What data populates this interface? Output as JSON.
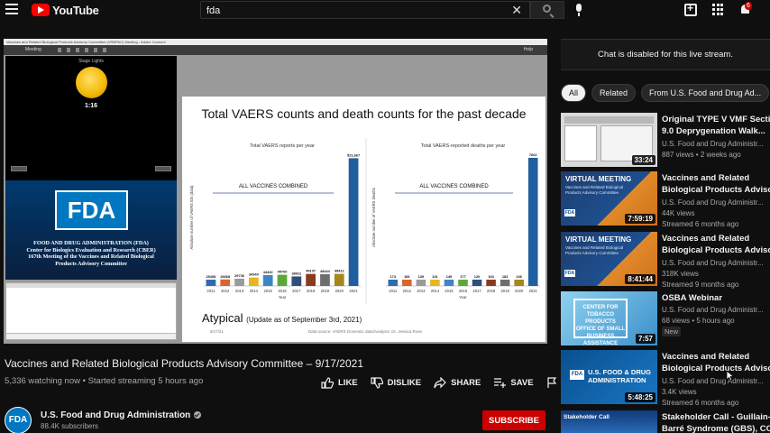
{
  "header": {
    "logo_text": "YouTube",
    "search_value": "fda",
    "notification_count": "6"
  },
  "player": {
    "app_bar_text": "Vaccines and Related Biological Products Advisory Committee (VRBPAC) Meeting - Adobe Connect",
    "toolbar_label": "Meeting",
    "toolbar_help": "Help",
    "pod_title": "Stage Lights",
    "timer": "1:16",
    "fda_logo": "FDA",
    "fda_caption": [
      "FOOD AND DRUG ADMINISTRATION (FDA)",
      "Center for Biologics Evaluation and Research (CBER)",
      "167th Meeting of the Vaccines and Related Biological",
      "Products Advisory Committee"
    ],
    "slide": {
      "title": "Total VAERS counts and death counts for the past decade",
      "atypical": "Atypical",
      "atypical_note": "(Update as of September 3rd, 2021)",
      "footer_date": "9/17/21",
      "footer_source": "Data source: VAERS Domestic data/Analysis: Dr. Jessica Rose"
    }
  },
  "chart_data": [
    {
      "type": "bar",
      "title": "Total VAERS reports per year",
      "annotation": "ALL VACCINES COMBINED",
      "ylabel": "Absolute number of VAERS IDs (data)",
      "xlabel": "Year",
      "categories": [
        "2011",
        "2012",
        "2013",
        "2014",
        "2015",
        "2016",
        "2017",
        "2018",
        "2019",
        "2020",
        "2021"
      ],
      "values": [
        25408,
        26668,
        29736,
        34340,
        44422,
        45700,
        38911,
        49137,
        48444,
        49412,
        521667
      ],
      "labels": [
        "25408",
        "26668",
        "29736",
        "34340",
        "44422",
        "45700",
        "38911",
        "49137",
        "48444",
        "49412",
        "521,667"
      ],
      "ylim": [
        0,
        560000
      ]
    },
    {
      "type": "bar",
      "title": "Total VAERS-reported deaths per year",
      "annotation": "ALL VACCINES COMBINED",
      "ylabel": "Absolute number of VAERS Deaths",
      "xlabel": "Year",
      "categories": [
        "2011",
        "2012",
        "2013",
        "2014",
        "2015",
        "2016",
        "2017",
        "2018",
        "2019",
        "2020",
        "2021"
      ],
      "values": [
        173,
        166,
        139,
        131,
        149,
        177,
        120,
        163,
        183,
        166,
        7662
      ],
      "labels": [
        "173",
        "166",
        "139",
        "131",
        "149",
        "177",
        "120",
        "163",
        "183",
        "166",
        "7662"
      ],
      "ylim": [
        0,
        8200
      ]
    }
  ],
  "video": {
    "title": "Vaccines and Related Biological Products Advisory Committee – 9/17/2021",
    "meta": "5,336 watching now • Started streaming 5 hours ago",
    "like": "LIKE",
    "dislike": "DISLIKE",
    "share": "SHARE",
    "save": "SAVE"
  },
  "channel": {
    "avatar": "FDA",
    "name": "U.S. Food and Drug Administration",
    "subs": "88.4K subscribers",
    "subscribe": "SUBSCRIBE"
  },
  "sidebar": {
    "chat_disabled": "Chat is disabled for this live stream.",
    "chips": [
      "All",
      "Related",
      "From U.S. Food and Drug Ad..."
    ],
    "recommendations": [
      {
        "title_1": "Original TYPE V VMF Section",
        "title_2": "9.0 Deprygenation Walk...",
        "channel": "U.S. Food and Drug Administr...",
        "line2": "887 views • 2 weeks ago",
        "line3": "",
        "duration": "33:24"
      },
      {
        "title_1": "Vaccines and Related",
        "title_2": "Biological Products Advisory...",
        "channel": "U.S. Food and Drug Administr...",
        "line2": "44K views",
        "line3": "Streamed 6 months ago",
        "duration": "7:59:19",
        "thumb_head": "VIRTUAL MEETING",
        "thumb_sub": "Vaccines and Related Biological Products Advisory Committee"
      },
      {
        "title_1": "Vaccines and Related",
        "title_2": "Biological Products Advisory...",
        "channel": "U.S. Food and Drug Administr...",
        "line2": "318K views",
        "line3": "Streamed 9 months ago",
        "duration": "8:41:44",
        "thumb_head": "VIRTUAL MEETING",
        "thumb_sub": "Vaccines and Related Biological Products Advisory Committee"
      },
      {
        "title_1": "OSBA Webinar",
        "title_2": "",
        "channel": "U.S. Food and Drug Administr...",
        "line2": "68 views • 5 hours ago",
        "line3": "",
        "badge": "New",
        "duration": "7:57",
        "thumb_text": "CENTER FOR TOBACCO PRODUCTS OFFICE OF SMALL BUSINESS ASSISTANCE"
      },
      {
        "title_1": "Vaccines and Related",
        "title_2": "Biological Products Advisory...",
        "channel": "U.S. Food and Drug Administr...",
        "line2": "3.4K views",
        "line3": "Streamed 6 months ago",
        "duration": "5:48:25",
        "thumb_text": "U.S. FOOD & DRUG ADMINISTRATION"
      },
      {
        "title_1": "Stakeholder Call - Guillain-",
        "title_2": "Barré Syndrome (GBS), COVI...",
        "channel": "",
        "line2": "",
        "line3": "",
        "duration": "",
        "thumb_head": "Stakeholder Call"
      }
    ]
  },
  "colors": {
    "accent_red": "#cc0000",
    "fda_blue": "#0077c0",
    "bar_highlight": "#1f5fa0"
  }
}
